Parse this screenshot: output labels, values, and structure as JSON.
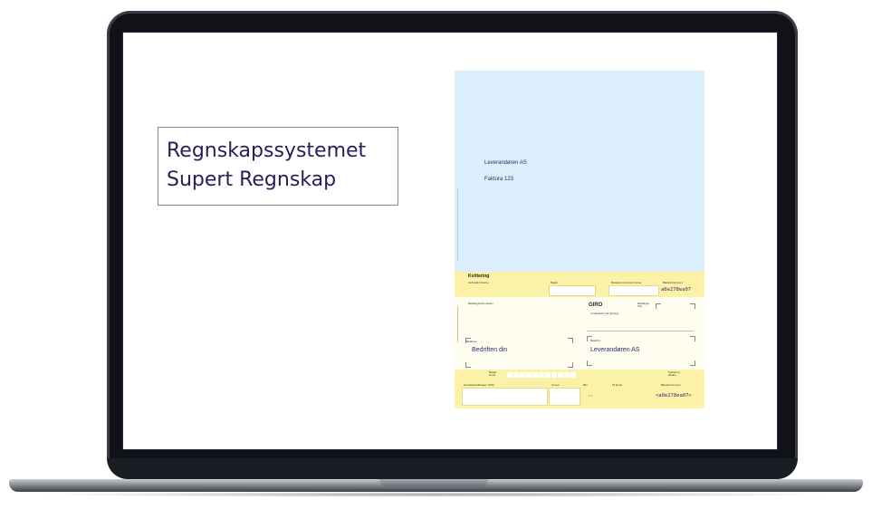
{
  "slide": {
    "title_line1": "Regnskapssystemet",
    "title_line2": "Supert Regnskap"
  },
  "invoice": {
    "supplier": "Leverandøren AS",
    "invoice_number": "Faktura 123",
    "receipt_heading": "Kvittering",
    "account_label": "Innbetalt til konto",
    "amount_label": "Beløp",
    "payer_account_label": "Betalerens kontonummer",
    "blankett_label": "Blankettnummer",
    "blankett_number": "a0e278ea07",
    "payment_info_label": "Betalingsinformasjon",
    "giro_title": "GIRO",
    "due_date_label": "Betalings-frist",
    "signature_label": "Underskrift ved girering",
    "paid_by_label": "Betalt av",
    "payer_name": "Bedriften din",
    "paid_to_label": "Betalt til",
    "payee_name": "Leverandøren AS",
    "debit_label": "Belast konto",
    "receipt_small": "Kvittering tilbake",
    "customer_id_label": "Kundeidentifikasjon (KID)",
    "kroner_label": "Kroner",
    "ore_label": "Øre",
    "to_account_label": "Til konto",
    "bottom_blankett_label": "Blankettnummer",
    "bottom_code": "<a0e278ea07>",
    "ore_marks": "‹   ›"
  }
}
